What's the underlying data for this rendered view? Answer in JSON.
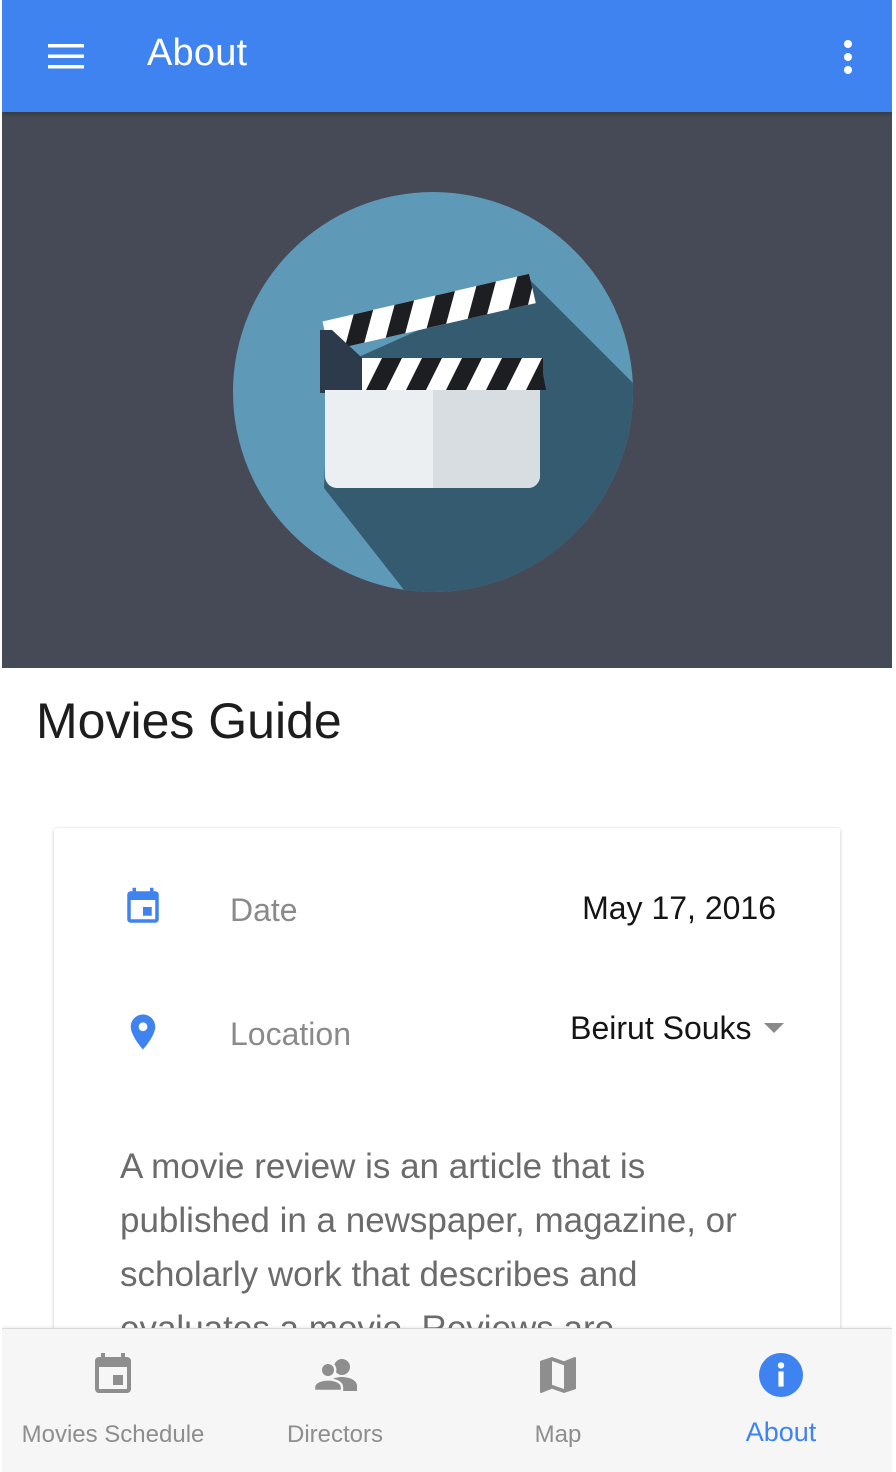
{
  "appbar": {
    "title": "About",
    "menu_icon": "hamburger-menu-icon",
    "overflow_icon": "more-vert-icon",
    "color": "#3f83f0"
  },
  "hero": {
    "background": "#454a56",
    "icon": "film-clapperboard-icon",
    "circle_color": "#5e99b8"
  },
  "app_name": "Movies Guide",
  "details": {
    "date": {
      "icon": "calendar-icon",
      "label": "Date",
      "value": "May 17, 2016"
    },
    "location": {
      "icon": "location-pin-icon",
      "label": "Location",
      "value": "Beirut Souks"
    }
  },
  "description": "A movie review is an article that is published in a newspaper, magazine, or scholarly work that describes and evaluates a movie. Reviews are",
  "bottom_nav": {
    "items": [
      {
        "label": "Movies Schedule",
        "icon": "calendar-icon",
        "active": false
      },
      {
        "label": "Directors",
        "icon": "people-icon",
        "active": false
      },
      {
        "label": "Map",
        "icon": "map-icon",
        "active": false
      },
      {
        "label": "About",
        "icon": "info-icon",
        "active": true
      }
    ],
    "active_color": "#3f83f0",
    "inactive_color": "#8e8e8e"
  }
}
